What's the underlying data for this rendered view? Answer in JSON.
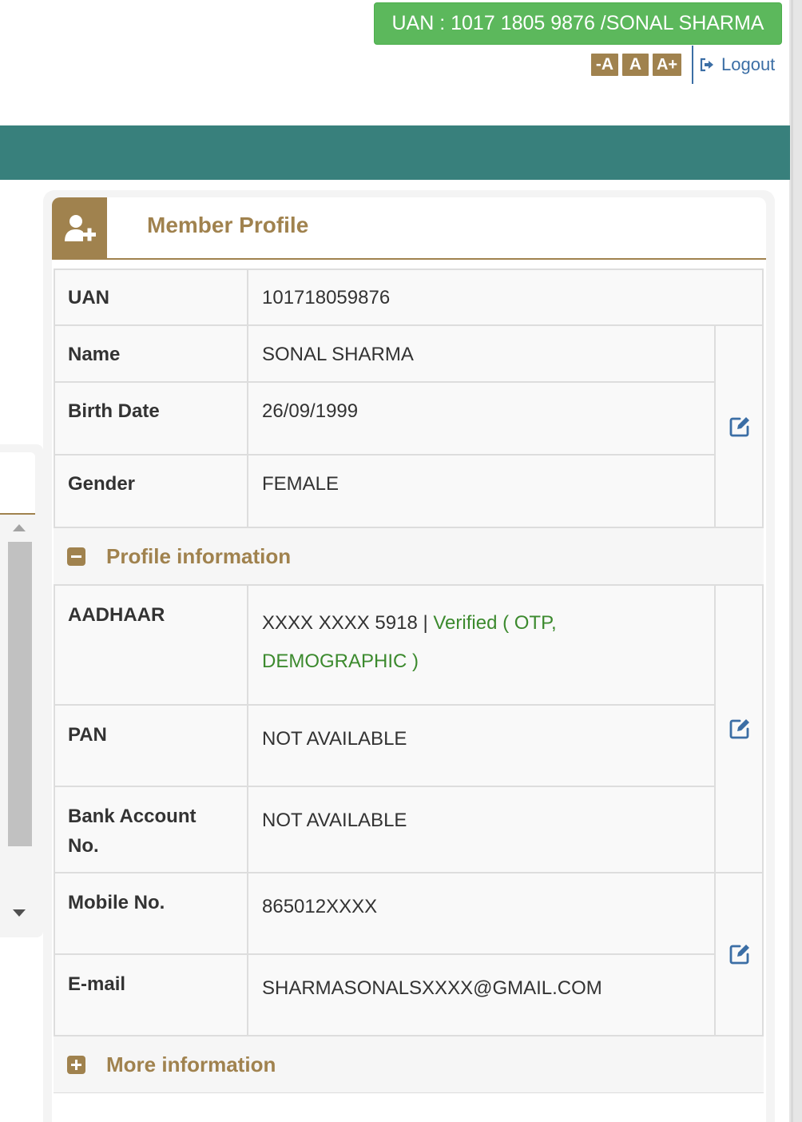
{
  "header": {
    "uan_badge": "UAN : 1017 1805 9876 /SONAL SHARMA",
    "font_decrease": "-A",
    "font_normal": "A",
    "font_increase": "A+",
    "logout_label": "Logout"
  },
  "card": {
    "title": "Member Profile"
  },
  "profile": {
    "uan_label": "UAN",
    "uan_value": "101718059876",
    "name_label": "Name",
    "name_value": "SONAL SHARMA",
    "birth_label": "Birth Date",
    "birth_value": "26/09/1999",
    "gender_label": "Gender",
    "gender_value": "FEMALE"
  },
  "profile_info": {
    "section_label": "Profile information",
    "aadhaar_label": "AADHAAR",
    "aadhaar_masked": "XXXX XXXX 5918",
    "aadhaar_sep": "|",
    "aadhaar_status_line1": "Verified ( OTP,",
    "aadhaar_status_line2": "DEMOGRAPHIC )",
    "pan_label": "PAN",
    "pan_value": "NOT AVAILABLE",
    "bank_label_line1": "Bank Account",
    "bank_label_line2": "No.",
    "bank_value": "NOT AVAILABLE",
    "mobile_label": "Mobile No.",
    "mobile_value": "865012XXXX",
    "email_label": "E-mail",
    "email_value": "SHARMASONALSXXXX@GMAIL.COM"
  },
  "more_info": {
    "section_label": "More information"
  },
  "colors": {
    "uan_badge_bg": "#5cb85c",
    "teal_bar": "#38807c",
    "accent_gold": "#a0824e",
    "link_blue": "#3b6ea5",
    "verified_green": "#3c8a2e"
  },
  "icons": {
    "header_icon": "user-plus-icon",
    "logout_icon": "sign-out-icon",
    "edit_icon": "edit-square-icon",
    "collapse_icon": "minus-square-icon",
    "expand_icon": "plus-square-icon"
  }
}
